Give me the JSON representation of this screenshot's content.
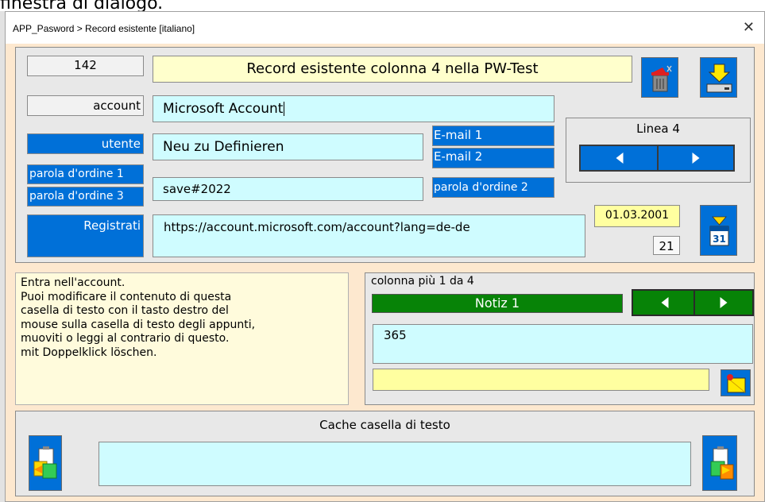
{
  "caption": "finestra di dialogo.",
  "window": {
    "title": "APP_Pasword > Record esistente  [italiano]",
    "close_glyph": "✕"
  },
  "header": {
    "record_number": "142",
    "record_title": "Record esistente colonna 4 nella PW-Test"
  },
  "fields": {
    "account_label": "account",
    "account_value": "Microsoft Account",
    "utente_label": "utente",
    "utente_value": "Neu zu Definieren",
    "email1_label": "E-mail 1",
    "email2_label": "E-mail 2",
    "parola1_label": "parola d'ordine 1",
    "parola3_label": "parola d'ordine 3",
    "parola2_label": "parola d'ordine 2",
    "password_value": "save#2022",
    "registrati_label": "Registrati",
    "url_value": "https://account.microsoft.com/account?lang=de-de",
    "date_value": "01.03.2001",
    "days_value": "21"
  },
  "line_nav": {
    "label": "Linea 4"
  },
  "info_text": {
    "lines": [
      "Entra nell'account.",
      "Puoi modificare il contenuto di questa",
      "casella di testo con il tasto destro del",
      "mouse sulla casella di testo degli appunti,",
      "muoviti o leggi al contrario di questo.",
      "mit Doppelklick löschen."
    ]
  },
  "column_panel": {
    "header": "colonna più 1 da 4",
    "note_title": "Notiz 1",
    "note_value": "365",
    "extra_value": ""
  },
  "cache": {
    "label": "Cache casella di testo",
    "value": ""
  },
  "calendar_icon": {
    "day": "31"
  },
  "icons": [
    "trash-icon",
    "save-drive-icon",
    "calendar-icon",
    "note-flag-icon",
    "clipboard-paste-left-icon",
    "clipboard-copy-right-icon"
  ],
  "colors": {
    "accent_blue": "#0070d8",
    "field_cyan": "#cffcff",
    "title_yellow": "#ffffcc",
    "green": "#078307",
    "dialog_bg": "#fde8cf"
  }
}
